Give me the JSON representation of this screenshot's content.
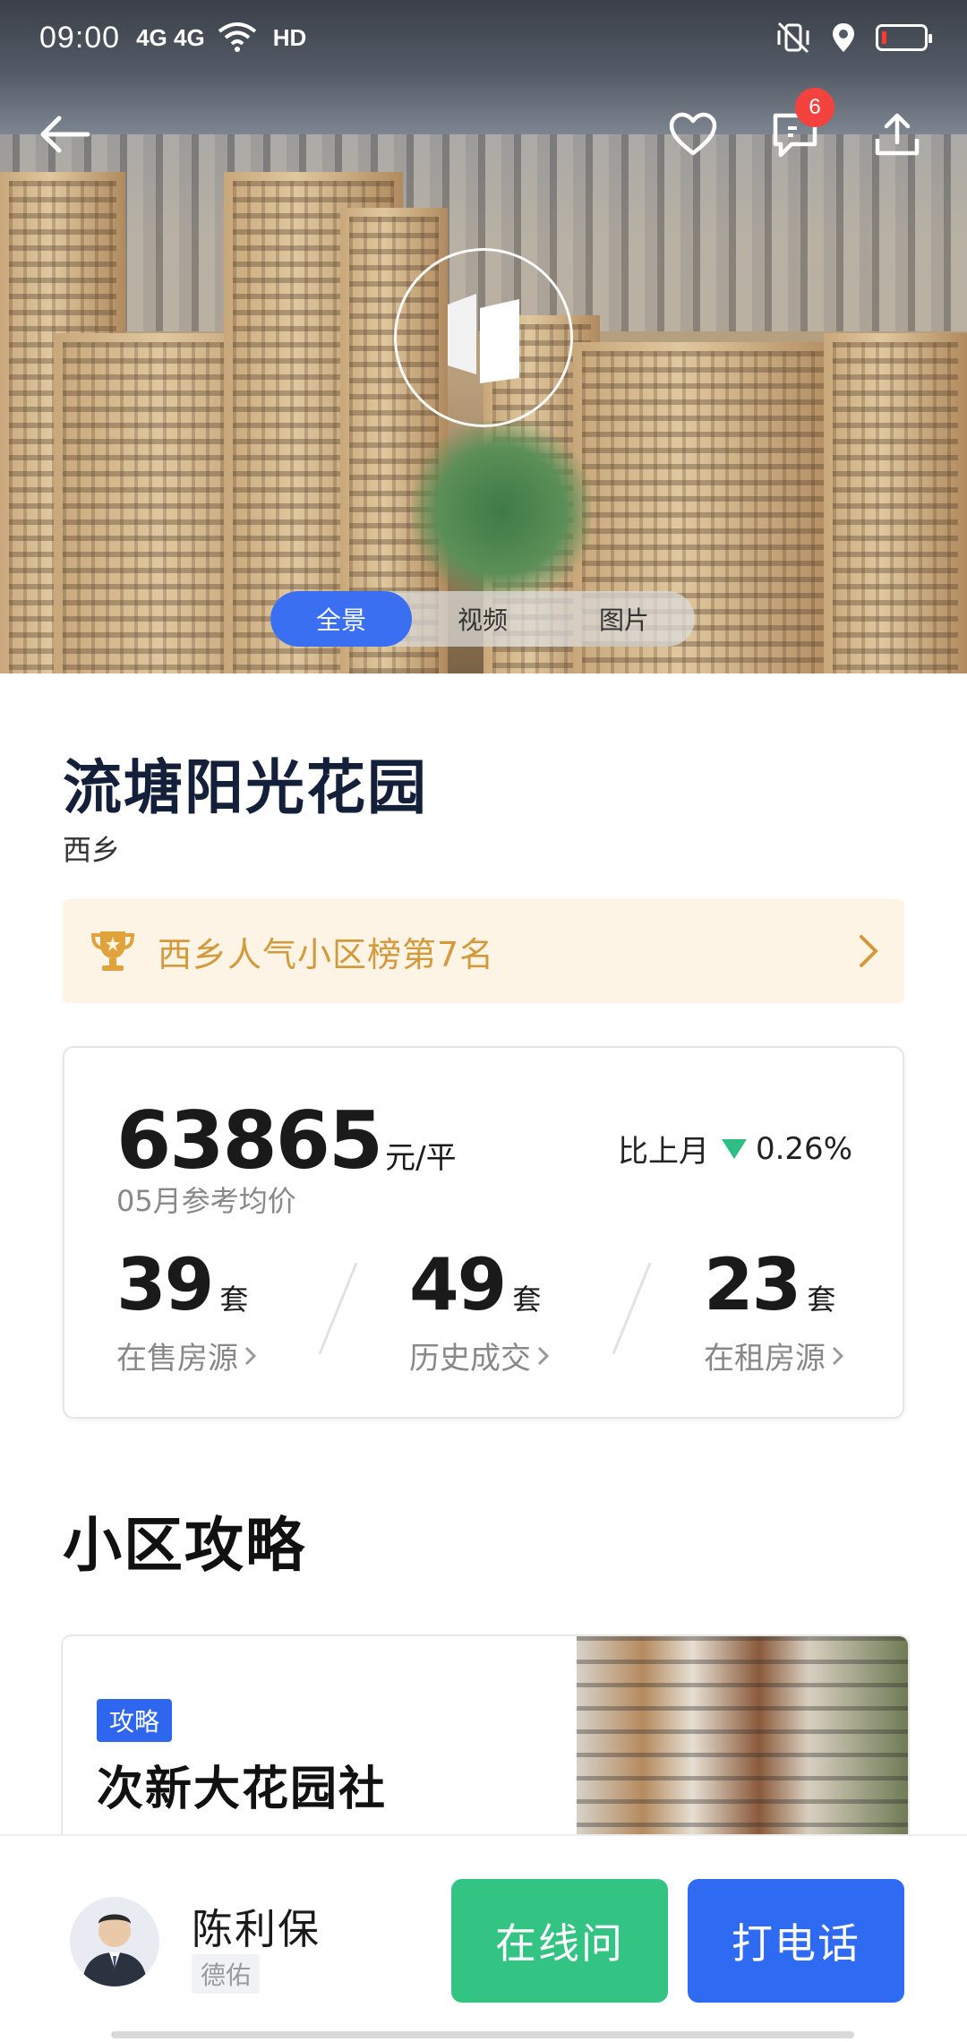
{
  "status_bar": {
    "time": "09:00",
    "signal_text": "4G 4G",
    "hd_text": "HD"
  },
  "header": {
    "message_badge": "6"
  },
  "media_tabs": [
    {
      "label": "全景",
      "active": true
    },
    {
      "label": "视频",
      "active": false
    },
    {
      "label": "图片",
      "active": false
    }
  ],
  "community": {
    "name": "流塘阳光花园",
    "district": "西乡"
  },
  "ranking": {
    "label": "西乡人气小区榜第7名"
  },
  "price": {
    "value": "63865",
    "unit": "元/平",
    "label": "05月参考均价",
    "change_label": "比上月",
    "change_value": "0.26%",
    "change_direction": "down",
    "change_color": "#2fbd86"
  },
  "stats": [
    {
      "number": "39",
      "unit": "套",
      "label": "在售房源"
    },
    {
      "number": "49",
      "unit": "套",
      "label": "历史成交"
    },
    {
      "number": "23",
      "unit": "套",
      "label": "在租房源"
    }
  ],
  "section": {
    "title": "小区攻略"
  },
  "guide": {
    "tag": "攻略",
    "title": "次新大花园社"
  },
  "agent": {
    "name": "陈利保",
    "company": "德佑"
  },
  "actions": {
    "online_label": "在线问",
    "call_label": "打电话",
    "online_color": "#33c383",
    "call_color": "#2f6af2"
  },
  "colors": {
    "accent": "#3a6ff2",
    "rank_text": "#d39a3c",
    "rank_bg": "#fdf4e6",
    "badge": "#f4433f"
  }
}
